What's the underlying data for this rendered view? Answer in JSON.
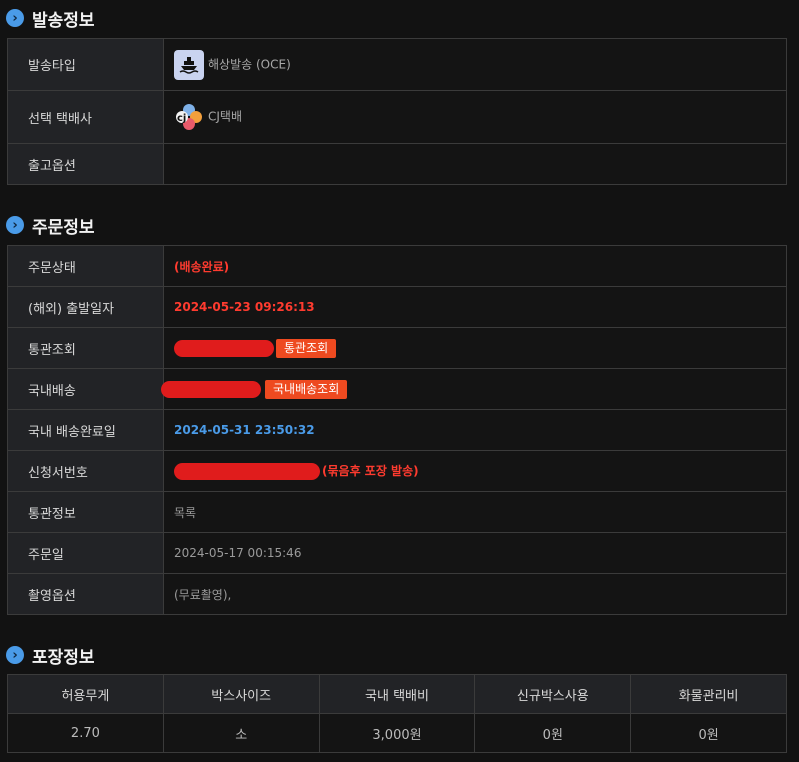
{
  "shipping_info": {
    "title": "발송정보",
    "rows": {
      "type_label": "발송타입",
      "type_value": "해상발송 (OCE)",
      "courier_label": "선택 택배사",
      "courier_value": "CJ택배",
      "release_label": "출고옵션",
      "release_value": ""
    }
  },
  "order_info": {
    "title": "주문정보",
    "status_label": "주문상태",
    "status_value": "(배송완료)",
    "departure_label": "(해외) 출발일자",
    "departure_value": "2024-05-23 09:26:13",
    "customs_label": "통관조회",
    "customs_button": "통관조회",
    "domestic_label": "국내배송",
    "domestic_button": "국내배송조회",
    "domestic_done_label": "국내 배송완료일",
    "domestic_done_value": "2024-05-31 23:50:32",
    "application_label": "신청서번호",
    "application_note": "(묶음후 포장 발송)",
    "customs_info_label": "통관정보",
    "customs_info_value": "목록",
    "order_date_label": "주문일",
    "order_date_value": "2024-05-17 00:15:46",
    "photo_label": "촬영옵션",
    "photo_value": "(무료촬영),"
  },
  "packing_info": {
    "title": "포장정보",
    "headers": [
      "허용무게",
      "박스사이즈",
      "국내 택배비",
      "신규박스사용",
      "화물관리비"
    ],
    "values": [
      "2.70",
      "소",
      "3,000원",
      "0원",
      "0원"
    ]
  },
  "colors": {
    "accent_blue": "#4a9be8",
    "status_red": "#ff3b2f",
    "button_orange": "#ee4a20",
    "redaction_red": "#e01c1c"
  },
  "icons": {
    "section": "chevron-right-icon",
    "ship": "ship-icon",
    "courier": "cj-logo-icon"
  }
}
